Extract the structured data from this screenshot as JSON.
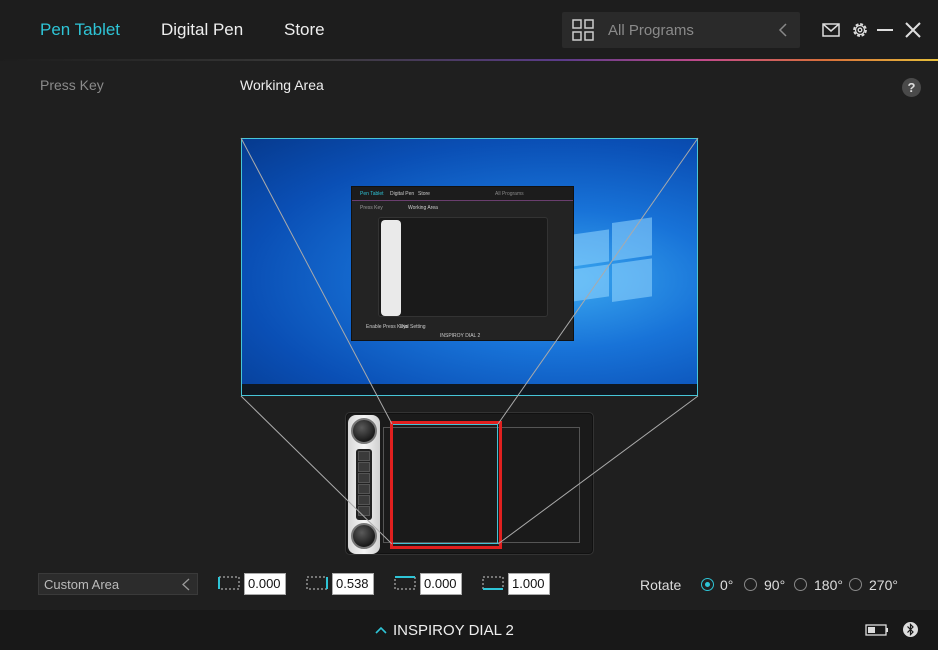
{
  "header": {
    "tabs": [
      {
        "label": "Pen Tablet",
        "active": true
      },
      {
        "label": "Digital Pen",
        "active": false
      },
      {
        "label": "Store",
        "active": false
      }
    ],
    "program_select": {
      "label": "All Programs"
    },
    "icons": [
      "mail-icon",
      "gear-icon",
      "minimize-icon",
      "close-icon"
    ]
  },
  "subheader": {
    "press_key": "Press Key",
    "working_area": "Working Area",
    "help": "?"
  },
  "preview": {
    "mini_app": {
      "tabs": [
        "Pen Tablet",
        "Digital Pen",
        "Store"
      ],
      "program_select": "All Programs",
      "press_key": "Press Key",
      "working_area": "Working Area",
      "enable_press_keys": "Enable Press Keys",
      "dial_setting": "Dial Setting",
      "device_name": "INSPIROY DIAL 2"
    }
  },
  "controls": {
    "area_mode": "Custom Area",
    "coords": [
      "0.000",
      "0.538",
      "0.000",
      "1.000"
    ],
    "rotate_label": "Rotate",
    "rotate_options": [
      "0°",
      "90°",
      "180°",
      "270°"
    ],
    "rotate_selected": "0°"
  },
  "footer": {
    "device_name": "INSPIROY DIAL 2"
  },
  "colors": {
    "accent": "#2ec4d6",
    "selection_red": "#e0201f",
    "background": "#1f1f1f"
  }
}
